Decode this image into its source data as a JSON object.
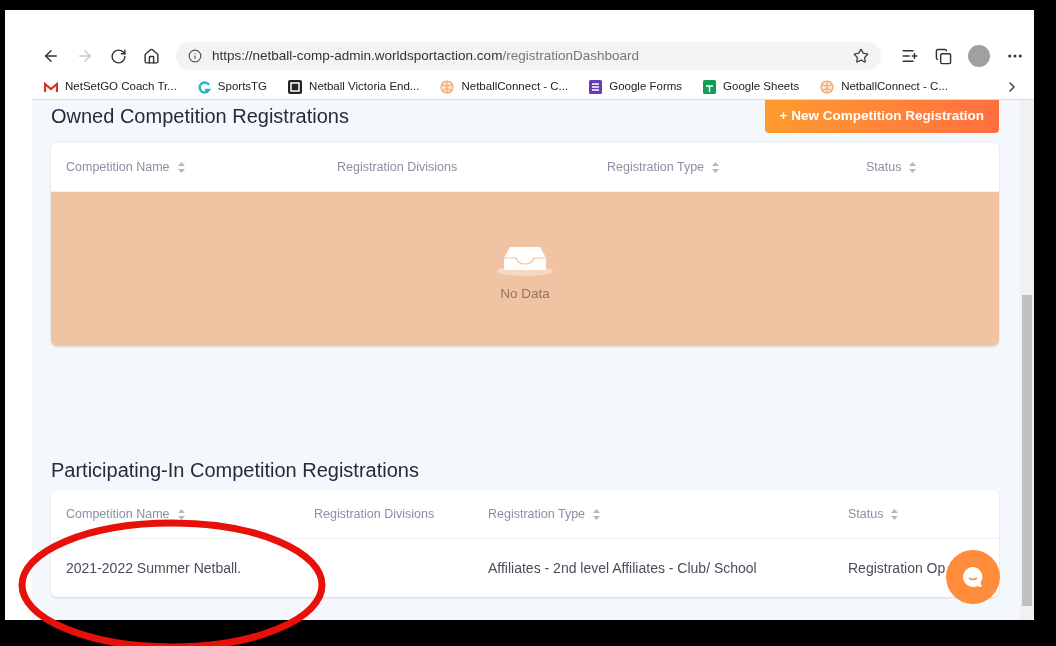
{
  "browser": {
    "url_origin": "https://netball-comp-admin.worldsportaction.com",
    "url_path": "/registrationDashboard",
    "forward_disabled": true
  },
  "bookmarks": [
    {
      "kind": "mail",
      "label": "NetSetGO Coach Tr..."
    },
    {
      "kind": "swirl",
      "label": "SportsTG"
    },
    {
      "kind": "square",
      "label": "Netball Victoria End..."
    },
    {
      "kind": "ball",
      "label": "NetballConnect - C..."
    },
    {
      "kind": "forms",
      "label": "Google Forms"
    },
    {
      "kind": "sheets",
      "label": "Google Sheets"
    },
    {
      "kind": "ball",
      "label": "NetballConnect - C..."
    }
  ],
  "owned": {
    "title": "Owned Competition Registrations",
    "button": "+ New Competition Registration",
    "columns": [
      {
        "label": "Competition Name",
        "sortable": true
      },
      {
        "label": "Registration Divisions",
        "sortable": false
      },
      {
        "label": "Registration Type",
        "sortable": true
      },
      {
        "label": "Status",
        "sortable": true
      }
    ],
    "empty_text": "No Data"
  },
  "participating": {
    "title": "Participating-In Competition Registrations",
    "columns": [
      {
        "label": "Competition Name",
        "sortable": true
      },
      {
        "label": "Registration Divisions",
        "sortable": false
      },
      {
        "label": "Registration Type",
        "sortable": true
      },
      {
        "label": "Status",
        "sortable": true
      }
    ],
    "rows": [
      {
        "cells": [
          "2021-2022 Summer Netball.",
          "",
          "Affiliates - 2nd level Affiliates - Club/ School",
          "Registration Op"
        ]
      }
    ]
  }
}
